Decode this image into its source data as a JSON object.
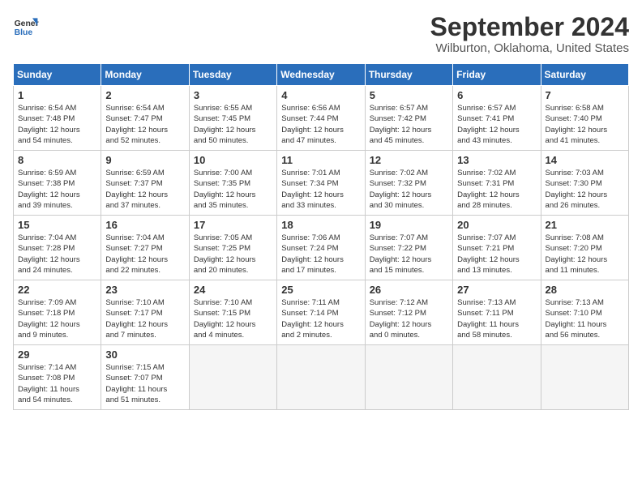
{
  "header": {
    "logo_line1": "General",
    "logo_line2": "Blue",
    "month": "September 2024",
    "location": "Wilburton, Oklahoma, United States"
  },
  "weekdays": [
    "Sunday",
    "Monday",
    "Tuesday",
    "Wednesday",
    "Thursday",
    "Friday",
    "Saturday"
  ],
  "weeks": [
    [
      {
        "day": "1",
        "info": "Sunrise: 6:54 AM\nSunset: 7:48 PM\nDaylight: 12 hours\nand 54 minutes."
      },
      {
        "day": "2",
        "info": "Sunrise: 6:54 AM\nSunset: 7:47 PM\nDaylight: 12 hours\nand 52 minutes."
      },
      {
        "day": "3",
        "info": "Sunrise: 6:55 AM\nSunset: 7:45 PM\nDaylight: 12 hours\nand 50 minutes."
      },
      {
        "day": "4",
        "info": "Sunrise: 6:56 AM\nSunset: 7:44 PM\nDaylight: 12 hours\nand 47 minutes."
      },
      {
        "day": "5",
        "info": "Sunrise: 6:57 AM\nSunset: 7:42 PM\nDaylight: 12 hours\nand 45 minutes."
      },
      {
        "day": "6",
        "info": "Sunrise: 6:57 AM\nSunset: 7:41 PM\nDaylight: 12 hours\nand 43 minutes."
      },
      {
        "day": "7",
        "info": "Sunrise: 6:58 AM\nSunset: 7:40 PM\nDaylight: 12 hours\nand 41 minutes."
      }
    ],
    [
      {
        "day": "8",
        "info": "Sunrise: 6:59 AM\nSunset: 7:38 PM\nDaylight: 12 hours\nand 39 minutes."
      },
      {
        "day": "9",
        "info": "Sunrise: 6:59 AM\nSunset: 7:37 PM\nDaylight: 12 hours\nand 37 minutes."
      },
      {
        "day": "10",
        "info": "Sunrise: 7:00 AM\nSunset: 7:35 PM\nDaylight: 12 hours\nand 35 minutes."
      },
      {
        "day": "11",
        "info": "Sunrise: 7:01 AM\nSunset: 7:34 PM\nDaylight: 12 hours\nand 33 minutes."
      },
      {
        "day": "12",
        "info": "Sunrise: 7:02 AM\nSunset: 7:32 PM\nDaylight: 12 hours\nand 30 minutes."
      },
      {
        "day": "13",
        "info": "Sunrise: 7:02 AM\nSunset: 7:31 PM\nDaylight: 12 hours\nand 28 minutes."
      },
      {
        "day": "14",
        "info": "Sunrise: 7:03 AM\nSunset: 7:30 PM\nDaylight: 12 hours\nand 26 minutes."
      }
    ],
    [
      {
        "day": "15",
        "info": "Sunrise: 7:04 AM\nSunset: 7:28 PM\nDaylight: 12 hours\nand 24 minutes."
      },
      {
        "day": "16",
        "info": "Sunrise: 7:04 AM\nSunset: 7:27 PM\nDaylight: 12 hours\nand 22 minutes."
      },
      {
        "day": "17",
        "info": "Sunrise: 7:05 AM\nSunset: 7:25 PM\nDaylight: 12 hours\nand 20 minutes."
      },
      {
        "day": "18",
        "info": "Sunrise: 7:06 AM\nSunset: 7:24 PM\nDaylight: 12 hours\nand 17 minutes."
      },
      {
        "day": "19",
        "info": "Sunrise: 7:07 AM\nSunset: 7:22 PM\nDaylight: 12 hours\nand 15 minutes."
      },
      {
        "day": "20",
        "info": "Sunrise: 7:07 AM\nSunset: 7:21 PM\nDaylight: 12 hours\nand 13 minutes."
      },
      {
        "day": "21",
        "info": "Sunrise: 7:08 AM\nSunset: 7:20 PM\nDaylight: 12 hours\nand 11 minutes."
      }
    ],
    [
      {
        "day": "22",
        "info": "Sunrise: 7:09 AM\nSunset: 7:18 PM\nDaylight: 12 hours\nand 9 minutes."
      },
      {
        "day": "23",
        "info": "Sunrise: 7:10 AM\nSunset: 7:17 PM\nDaylight: 12 hours\nand 7 minutes."
      },
      {
        "day": "24",
        "info": "Sunrise: 7:10 AM\nSunset: 7:15 PM\nDaylight: 12 hours\nand 4 minutes."
      },
      {
        "day": "25",
        "info": "Sunrise: 7:11 AM\nSunset: 7:14 PM\nDaylight: 12 hours\nand 2 minutes."
      },
      {
        "day": "26",
        "info": "Sunrise: 7:12 AM\nSunset: 7:12 PM\nDaylight: 12 hours\nand 0 minutes."
      },
      {
        "day": "27",
        "info": "Sunrise: 7:13 AM\nSunset: 7:11 PM\nDaylight: 11 hours\nand 58 minutes."
      },
      {
        "day": "28",
        "info": "Sunrise: 7:13 AM\nSunset: 7:10 PM\nDaylight: 11 hours\nand 56 minutes."
      }
    ],
    [
      {
        "day": "29",
        "info": "Sunrise: 7:14 AM\nSunset: 7:08 PM\nDaylight: 11 hours\nand 54 minutes."
      },
      {
        "day": "30",
        "info": "Sunrise: 7:15 AM\nSunset: 7:07 PM\nDaylight: 11 hours\nand 51 minutes."
      },
      {
        "day": "",
        "info": ""
      },
      {
        "day": "",
        "info": ""
      },
      {
        "day": "",
        "info": ""
      },
      {
        "day": "",
        "info": ""
      },
      {
        "day": "",
        "info": ""
      }
    ]
  ]
}
